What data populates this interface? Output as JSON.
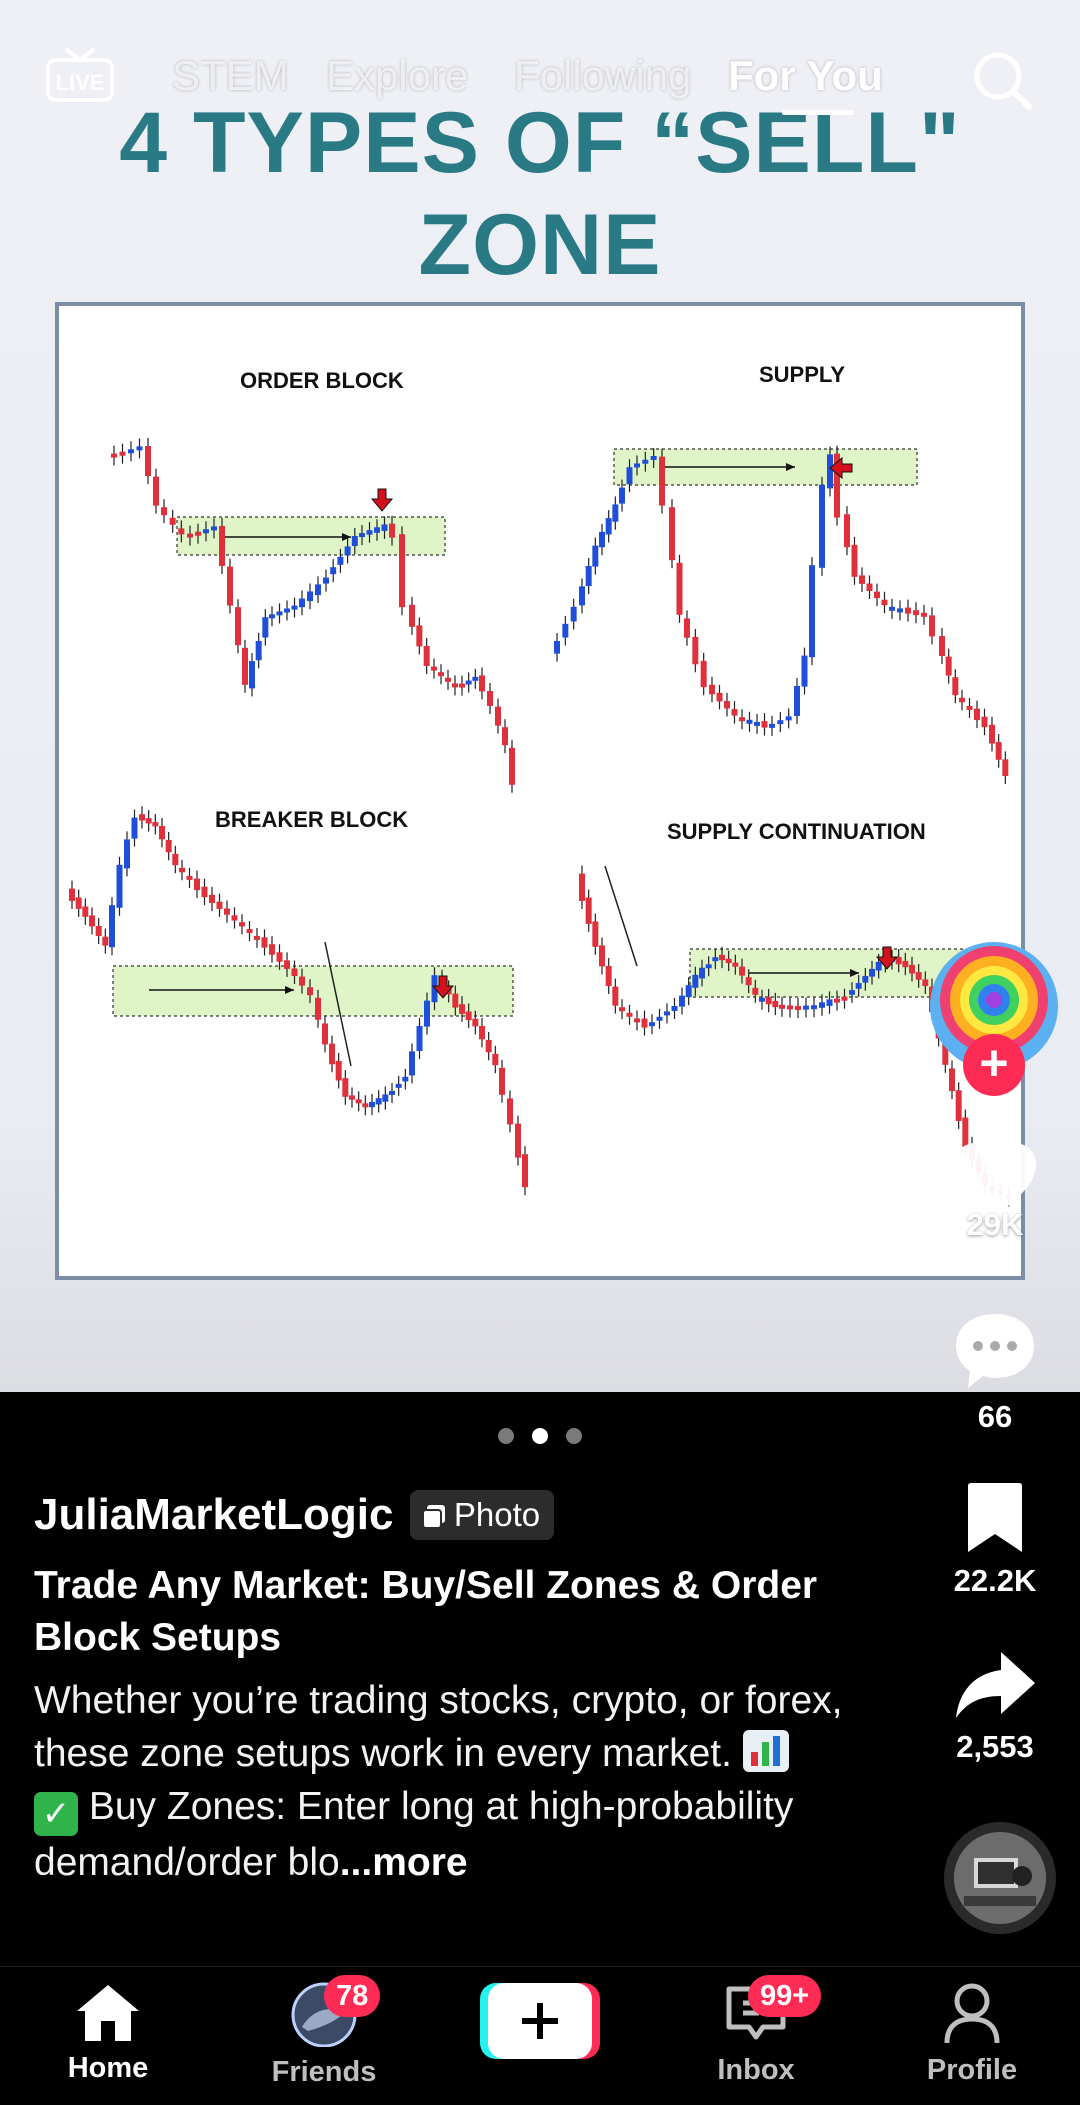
{
  "nav": {
    "tabs": [
      "STEM",
      "Explore",
      "Following",
      "For You"
    ],
    "active_tab": "For You",
    "live_label": "LIVE"
  },
  "slide": {
    "title_line1": "4 TYPES OF “SELL\"",
    "title_line2": "ZONE",
    "panels": [
      "ORDER BLOCK",
      "SUPPLY",
      "BREAKER BLOCK",
      "SUPPLY CONTINUATION"
    ],
    "colors": {
      "bull": "#1f4fd8",
      "bear": "#e0303c",
      "zone": "#dff5c8",
      "title": "#2a7a86",
      "arrow": "#d3101c"
    },
    "current_slide": 2,
    "slide_count": 3
  },
  "actions": {
    "likes": "29K",
    "comments": "66",
    "saves": "22.2K",
    "shares": "2,553"
  },
  "post": {
    "username": "JuliaMarketLogic",
    "badge": "Photo",
    "title": "Trade Any Market: Buy/Sell Zones & Order Block Setups",
    "body_1": "Whether you’re trading stocks, crypto, or forex, these zone setups work in every market. ",
    "body_2": " Buy Zones: Enter long at high-probability demand/order blo",
    "more": "...more"
  },
  "tabbar": {
    "home": "Home",
    "friends": "Friends",
    "friends_badge": "78",
    "inbox": "Inbox",
    "inbox_badge": "99+",
    "profile": "Profile"
  }
}
